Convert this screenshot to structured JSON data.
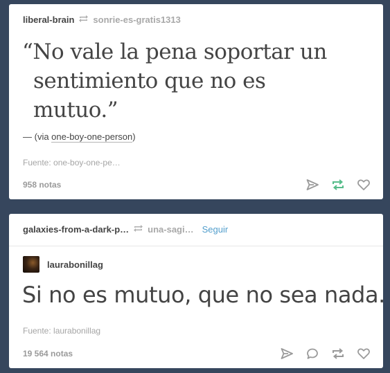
{
  "posts": [
    {
      "blog_name": "liberal-brain",
      "reblog_source": "sonrie-es-gratis1313",
      "quote_lines": [
        "“No vale la pena soportar un",
        "sentimiento que no es",
        "mutuo.”"
      ],
      "source_prefix": "— (via ",
      "source_link": "one-boy-one-person",
      "source_suffix": ")",
      "credit": "Fuente: one-boy-one-pe…",
      "notes": "958 notas",
      "actions": [
        "send-icon",
        "reblog-icon",
        "like-icon"
      ],
      "reblog_color": "#56bc8a"
    },
    {
      "blog_name": "galaxies-from-a-dark-p…",
      "reblog_source": "una-sagi…",
      "follow_label": "Seguir",
      "author": "laurabonillag",
      "text": "Si no es mutuo, que no sea nada.",
      "credit": "Fuente: laurabonillag",
      "notes": "19 564 notas",
      "actions": [
        "send-icon",
        "reply-icon",
        "reblog-icon",
        "like-icon"
      ]
    }
  ],
  "colors": {
    "dashboard_background": "#36465d",
    "card": "#ffffff",
    "text": "#444444",
    "muted": "#a8a8a8",
    "link": "#529ecc"
  }
}
